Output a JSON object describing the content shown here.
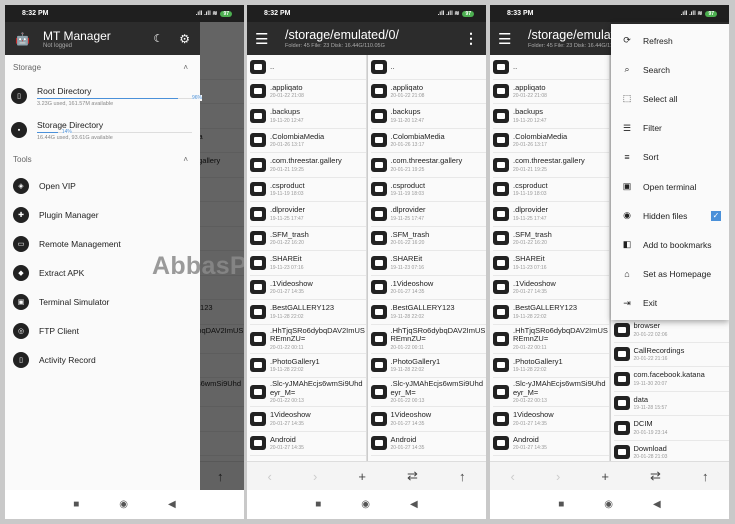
{
  "status": {
    "time1": "8:32 PM",
    "time2": "8:32 PM",
    "time3": "8:33 PM",
    "battery": "97"
  },
  "toolbar": {
    "path": "/storage/emulated/0/",
    "info": "Folder: 45  File: 23  Disk: 16.44G/110.05G"
  },
  "files": [
    {
      "name": "..",
      "date": ""
    },
    {
      "name": ".appliqato",
      "date": "20-01-22 21:08"
    },
    {
      "name": ".backups",
      "date": "19-11-20 12:47"
    },
    {
      "name": ".ColombiaMedia",
      "date": "20-01-26 13:17"
    },
    {
      "name": ".com.threestar.gallery",
      "date": "20-01-21 19:25"
    },
    {
      "name": ".csproduct",
      "date": "19-11-19 18:03"
    },
    {
      "name": ".dlprovider",
      "date": "19-11-25 17:47"
    },
    {
      "name": ".SFM_trash",
      "date": "20-01-22 16:20"
    },
    {
      "name": ".SHAREit",
      "date": "19-11-23 07:16"
    },
    {
      "name": ".1Videoshow",
      "date": "20-01-27 14:35"
    },
    {
      "name": ".BestGALLERY123",
      "date": "19-11-28 22:02"
    },
    {
      "name": ".HhTjqSRo6dybqDAV2ImUSREmnZU=",
      "date": "20-01-22 00:11"
    },
    {
      "name": ".PhotoGallery1",
      "date": "19-11-28 22:02"
    },
    {
      "name": ".Slc-yJMAhEcjs6wmSi9Uhdeyr_M=",
      "date": "20-01-22 00:13"
    },
    {
      "name": "1Videoshow",
      "date": "20-01-27 14:35"
    },
    {
      "name": "Android",
      "date": "20-01-27 14:35"
    }
  ],
  "files_right3": [
    {
      "name": "browser",
      "date": "20-01-22 02:06"
    },
    {
      "name": "CallRecordings",
      "date": "20-01-22 21:16"
    },
    {
      "name": "com.facebook.katana",
      "date": "19-11-30 20:07"
    },
    {
      "name": "data",
      "date": "19-11-28 15:57"
    },
    {
      "name": "DCIM",
      "date": "20-01-19 23:14"
    },
    {
      "name": "Download",
      "date": "20-01-28 21:03"
    }
  ],
  "drawer": {
    "title": "MT Manager",
    "subtitle": "Not logged",
    "storage_label": "Storage",
    "tools_label": "Tools",
    "storage": [
      {
        "name": "Root Directory",
        "percent": 96,
        "percent_label": "96%",
        "usage": "3.23G used, 161.57M available"
      },
      {
        "name": "Storage Directory",
        "percent": 14,
        "percent_label": "14%",
        "usage": "16.44G used, 93.61G available"
      }
    ],
    "tools": [
      {
        "label": "Open VIP",
        "icon": "vip-icon"
      },
      {
        "label": "Plugin Manager",
        "icon": "puzzle-icon"
      },
      {
        "label": "Remote Management",
        "icon": "monitor-icon"
      },
      {
        "label": "Extract APK",
        "icon": "package-icon"
      },
      {
        "label": "Terminal Simulator",
        "icon": "terminal-icon"
      },
      {
        "label": "FTP Client",
        "icon": "ftp-icon"
      },
      {
        "label": "Activity Record",
        "icon": "phone-icon"
      }
    ]
  },
  "menu": [
    {
      "label": "Refresh",
      "icon": "refresh-icon",
      "glyph": "⟳"
    },
    {
      "label": "Search",
      "icon": "search-icon",
      "glyph": "⌕"
    },
    {
      "label": "Select all",
      "icon": "select-all-icon",
      "glyph": "⬚"
    },
    {
      "label": "Filter",
      "icon": "filter-icon",
      "glyph": "☰"
    },
    {
      "label": "Sort",
      "icon": "sort-icon",
      "glyph": "≡"
    },
    {
      "label": "Open terminal",
      "icon": "terminal-icon",
      "glyph": "▣"
    },
    {
      "label": "Hidden files",
      "icon": "eye-icon",
      "glyph": "◉",
      "checked": true
    },
    {
      "label": "Add to bookmarks",
      "icon": "bookmark-icon",
      "glyph": "◧"
    },
    {
      "label": "Set as Homepage",
      "icon": "home-icon",
      "glyph": "⌂"
    },
    {
      "label": "Exit",
      "icon": "exit-icon",
      "glyph": "⇥"
    }
  ],
  "watermark": "AbbasPC.Net",
  "accent": "#4a90d9"
}
